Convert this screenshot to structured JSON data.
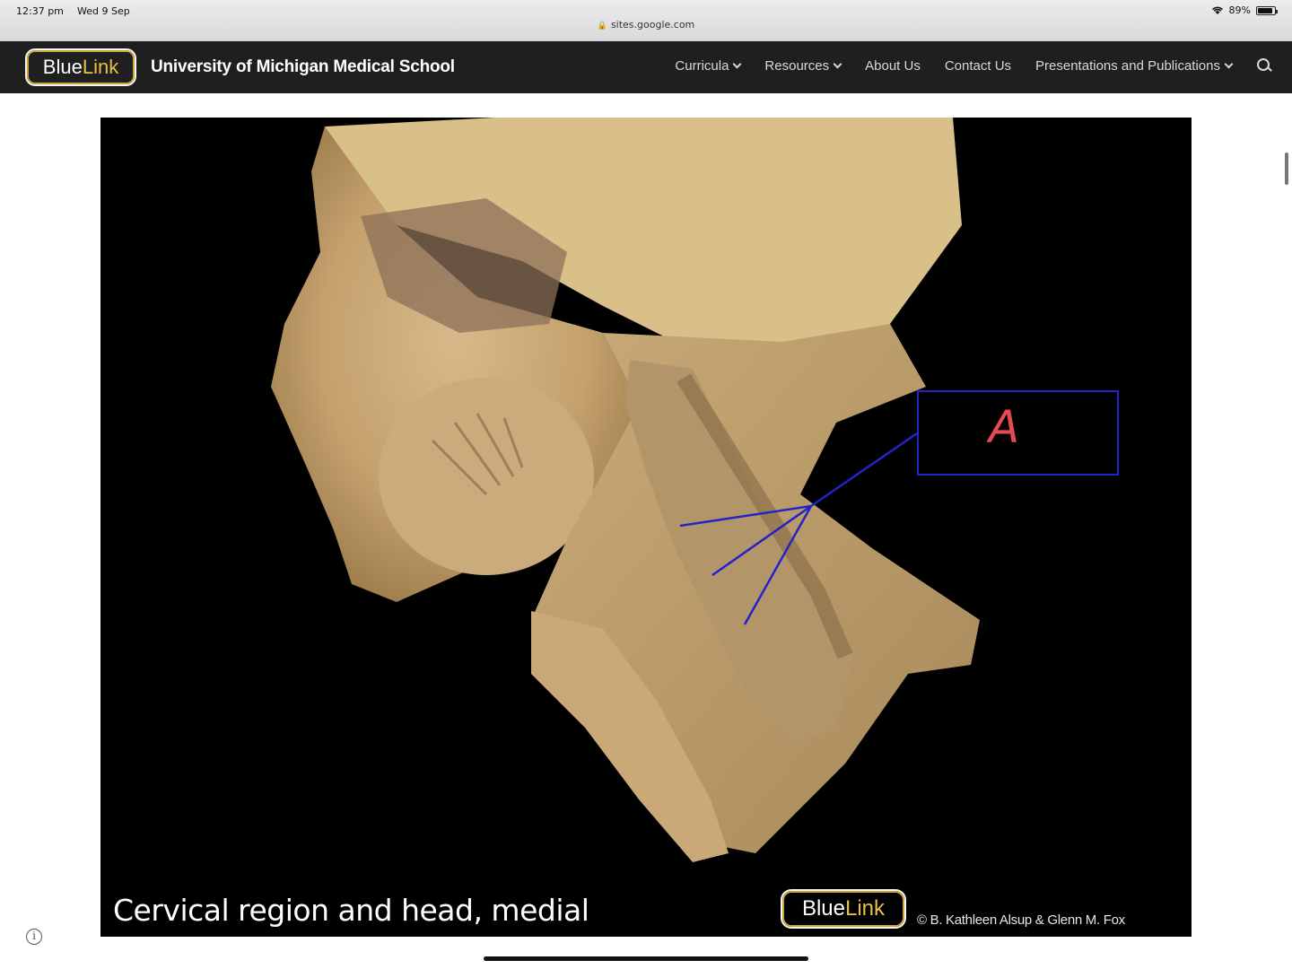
{
  "status_bar": {
    "time": "12:37 pm",
    "date": "Wed 9 Sep",
    "battery": "89%",
    "url": "sites.google.com"
  },
  "navbar": {
    "logo_blue": "Blue",
    "logo_link": "Link",
    "site_title": "University of Michigan Medical School",
    "items": [
      {
        "label": "Curricula",
        "has_dropdown": true
      },
      {
        "label": "Resources",
        "has_dropdown": true
      },
      {
        "label": "About Us",
        "has_dropdown": false
      },
      {
        "label": "Contact Us",
        "has_dropdown": false
      },
      {
        "label": "Presentations and Publications",
        "has_dropdown": true
      }
    ],
    "search_icon": "search-icon"
  },
  "figure": {
    "caption": "Cervical region and head, medial",
    "logo_blue": "Blue",
    "logo_link": "Link",
    "copyright": "© B. Kathleen Alsup & Glenn M. Fox",
    "annotation_label": "A",
    "annotation_color": "#2323c8",
    "letter_color": "#e84a55"
  },
  "colors": {
    "nav_bg": "#1f1f1f",
    "brand_gold": "#c9a43a"
  }
}
